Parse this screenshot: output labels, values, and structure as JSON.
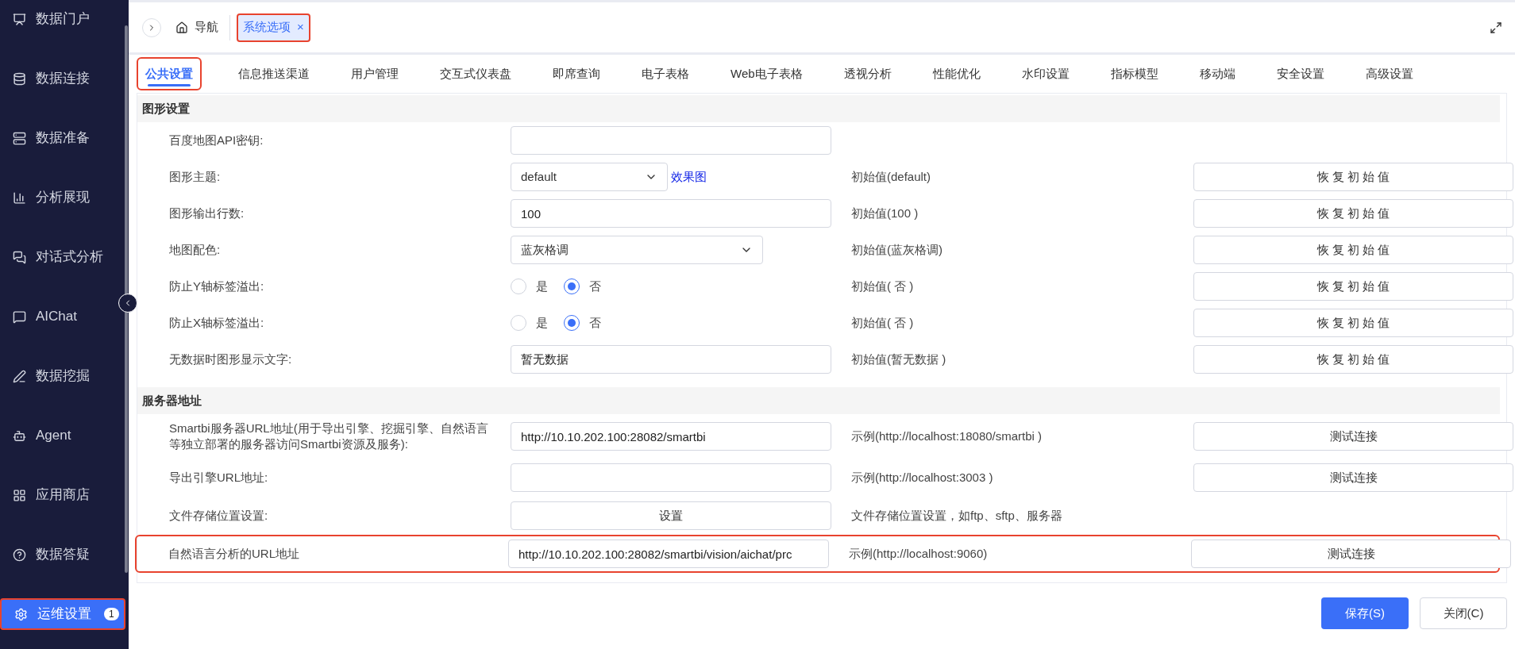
{
  "sidebar": {
    "items": [
      {
        "label": "数据门户",
        "selected": false
      },
      {
        "label": "数据连接",
        "selected": false
      },
      {
        "label": "数据准备",
        "selected": false
      },
      {
        "label": "分析展现",
        "selected": false
      },
      {
        "label": "对话式分析",
        "selected": false
      },
      {
        "label": "AIChat",
        "selected": false
      },
      {
        "label": "数据挖掘",
        "selected": false
      },
      {
        "label": "Agent",
        "selected": false
      },
      {
        "label": "应用商店",
        "selected": false
      },
      {
        "label": "数据答疑",
        "selected": false
      },
      {
        "label": "运维设置",
        "selected": true,
        "badge": "1",
        "highlighted": true
      }
    ]
  },
  "top_bar": {
    "home": "导航",
    "tabs": [
      {
        "label": "系统选项",
        "close": "×",
        "selected": true,
        "highlighted": true
      }
    ]
  },
  "settings_tabs": [
    {
      "label": "公共设置",
      "selected": true,
      "highlighted": true
    },
    {
      "label": "信息推送渠道",
      "selected": false
    },
    {
      "label": "用户管理",
      "selected": false
    },
    {
      "label": "交互式仪表盘",
      "selected": false
    },
    {
      "label": "即席查询",
      "selected": false
    },
    {
      "label": "电子表格",
      "selected": false
    },
    {
      "label": "Web电子表格",
      "selected": false
    },
    {
      "label": "透视分析",
      "selected": false
    },
    {
      "label": "性能优化",
      "selected": false
    },
    {
      "label": "水印设置",
      "selected": false
    },
    {
      "label": "指标模型",
      "selected": false
    },
    {
      "label": "移动端",
      "selected": false
    },
    {
      "label": "安全设置",
      "selected": false
    },
    {
      "label": "高级设置",
      "selected": false
    }
  ],
  "sections": [
    {
      "title": "图形设置",
      "rows": [
        {
          "kind": "input",
          "label": "百度地图API密钥:"
        },
        {
          "kind": "select",
          "label": "图形主题:",
          "value": "default",
          "link": "效果图",
          "note": "初始值(default)",
          "action": "恢 复 初 始 值"
        },
        {
          "kind": "input",
          "label": "图形输出行数:",
          "value": "100",
          "note": "初始值(100 )",
          "action": "恢 复 初 始 值"
        },
        {
          "kind": "select",
          "label": "地图配色:",
          "value": "蓝灰格调",
          "note": "初始值(蓝灰格调)",
          "action": "恢 复 初 始 值"
        },
        {
          "kind": "radio",
          "label": "防止Y轴标签溢出:",
          "options": [
            {
              "label": "是",
              "selected": false
            },
            {
              "label": "否",
              "selected": true
            }
          ],
          "note": "初始值( 否 )",
          "action": "恢 复 初 始 值"
        },
        {
          "kind": "radio",
          "label": "防止X轴标签溢出:",
          "options": [
            {
              "label": "是",
              "selected": false
            },
            {
              "label": "否",
              "selected": true
            }
          ],
          "note": "初始值( 否 )",
          "action": "恢 复 初 始 值"
        },
        {
          "kind": "input",
          "label": "无数据时图形显示文字:",
          "value": "暂无数据",
          "note": "初始值(暂无数据 )",
          "action": "恢 复 初 始 值"
        }
      ]
    },
    {
      "title": "服务器地址",
      "rows": [
        {
          "kind": "input",
          "label": "Smartbi服务器URL地址(用于导出引擎、挖掘引擎、自然语言等独立部署的服务器访问Smartbi资源及服务):",
          "value": "http://10.10.202.100:28082/smartbi",
          "note": "示例(http://localhost:18080/smartbi )",
          "action": "测试连接"
        },
        {
          "kind": "input",
          "label": "导出引擎URL地址:",
          "note": "示例(http://localhost:3003 )",
          "action": "测试连接"
        },
        {
          "kind": "button",
          "label": "文件存储位置设置:",
          "value": "设置",
          "note": "文件存储位置设置，如ftp、sftp、服务器"
        },
        {
          "kind": "input",
          "label": "自然语言分析的URL地址",
          "value": "http://10.10.202.100:28082/smartbi/vision/aichat/prc",
          "note": "示例(http://localhost:9060)",
          "action": "测试连接",
          "highlighted": true
        }
      ]
    }
  ],
  "footer": {
    "buttons": [
      {
        "label": "保存(S)",
        "kind": "primary"
      },
      {
        "label": "关闭(C)",
        "kind": "default"
      }
    ]
  }
}
